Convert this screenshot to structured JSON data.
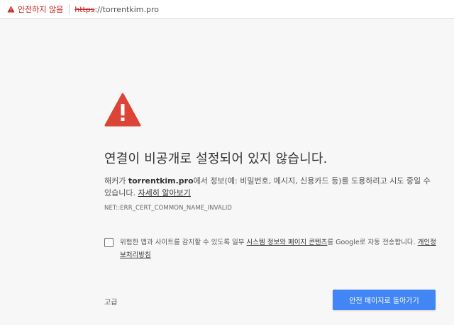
{
  "omnibox": {
    "security_label": "안전하지 않음",
    "url_scheme": "https",
    "url_rest": "://torrentkim.pro"
  },
  "interstitial": {
    "heading": "연결이 비공개로 설정되어 있지 않습니다.",
    "desc_before": "해커가 ",
    "desc_domain": "torrentkim.pro",
    "desc_after": "에서 정보(예: 비밀번호, 메시지, 신용카드 등)를 도용하려고 시도 중일 수 있습니다. ",
    "learn_more": "자세히 알아보기",
    "error_code": "NET::ERR_CERT_COMMON_NAME_INVALID",
    "optin_before": "위험한 앱과 사이트를 감지할 수 있도록 일부 ",
    "optin_link": "시스템 정보와 페이지 콘텐츠",
    "optin_after": "를 Google로 자동 전송합니다. ",
    "privacy_link": "개인정보처리방침",
    "advanced_label": "고급",
    "back_button_label": "안전 페이지로 돌아가기"
  },
  "colors": {
    "warning_red": "#db4437",
    "button_blue": "#4285f4",
    "background": "#f7f7f7"
  },
  "icons": [
    "warning-triangle-icon",
    "not-secure-icon"
  ]
}
